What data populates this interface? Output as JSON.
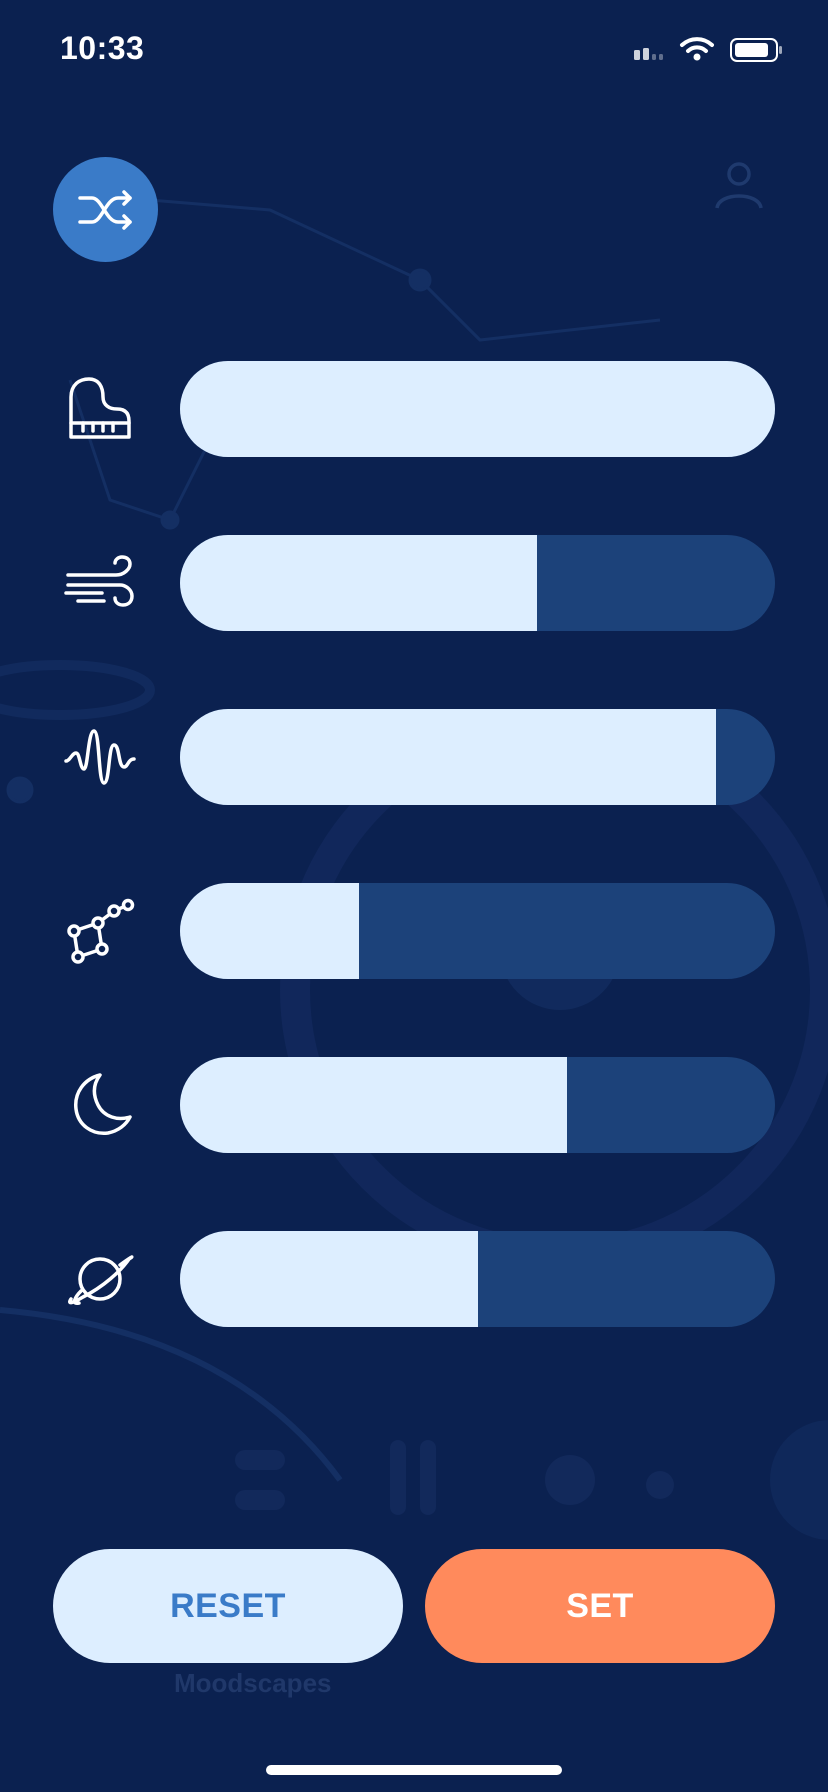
{
  "status_bar": {
    "time": "10:33"
  },
  "colors": {
    "background": "#0b2150",
    "slider_track": "#1c427a",
    "slider_fill": "#ddeeff",
    "shuffle_button": "#3a7bc8",
    "reset_text": "#3a7bc8",
    "set_button": "#ff8a5c"
  },
  "shuffle_button": {
    "icon": "shuffle-icon"
  },
  "mixer": {
    "sliders": [
      {
        "icon": "piano-icon",
        "level": 1.0
      },
      {
        "icon": "wind-icon",
        "level": 0.6
      },
      {
        "icon": "waveform-icon",
        "level": 0.9
      },
      {
        "icon": "constellation-icon",
        "level": 0.3
      },
      {
        "icon": "moon-icon",
        "level": 0.65
      },
      {
        "icon": "planet-icon",
        "level": 0.5
      }
    ]
  },
  "actions": {
    "reset_label": "RESET",
    "set_label": "SET"
  },
  "tab_bar": {
    "visible_label": "Moodscapes"
  }
}
